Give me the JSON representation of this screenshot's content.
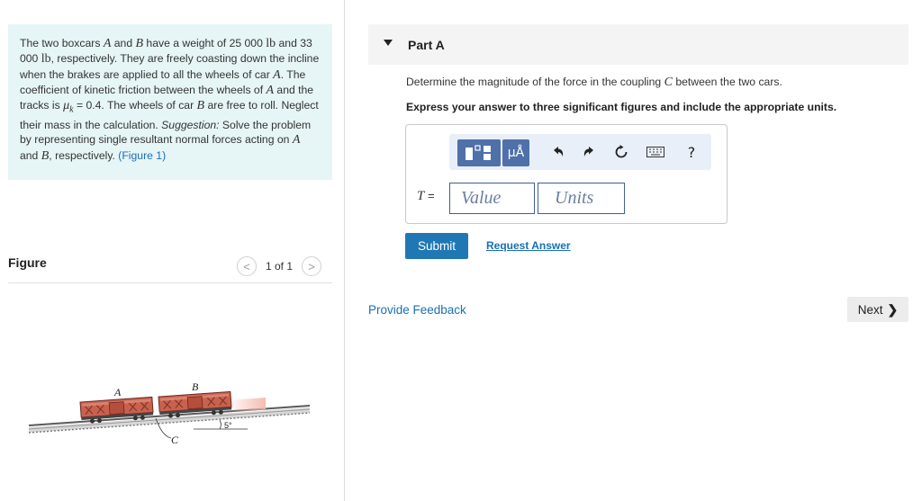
{
  "problem": {
    "text_1": "The two boxcars ",
    "var_a": "A",
    "text_2": " and ",
    "var_b": "B",
    "text_3": " have a weight of 25 000 ",
    "unit_lb_1": "lb",
    "text_4": " and 33 000 ",
    "unit_lb_2": "lb",
    "text_5": ", respectively. They are freely coasting down the incline when the brakes are applied to all the wheels of car ",
    "var_a2": "A",
    "text_6": ". The coefficient of kinetic friction between the wheels of ",
    "var_a3": "A",
    "text_7": " and the tracks is ",
    "mu_symbol": "μ",
    "mu_sub": "k",
    "text_8": " = 0.4. The wheels of car ",
    "var_b2": "B",
    "text_9": " are free to roll. Neglect their mass in the calculation. ",
    "suggestion_label": "Suggestion:",
    "text_10": " Solve the problem by representing single resultant normal forces acting on ",
    "var_a4": "A",
    "text_11": " and ",
    "var_b3": "B",
    "text_12": ", respectively. ",
    "figure_link": "(Figure 1)"
  },
  "figure": {
    "title": "Figure",
    "pager_text": "1 of 1",
    "prev_glyph": "<",
    "next_glyph": ">",
    "label_a": "A",
    "label_b": "B",
    "label_c": "C",
    "label_angle": "5°"
  },
  "part": {
    "title": "Part A",
    "question_1": "Determine the magnitude of the force in the coupling ",
    "question_var": "C",
    "question_2": " between the two cars.",
    "instruction": "Express your answer to three significant figures and include the appropriate units."
  },
  "answer": {
    "t_label": "T",
    "equals": " =",
    "value_placeholder": "Value",
    "units_placeholder": "Units",
    "unit_button_label": "μÅ",
    "help_label": "?"
  },
  "actions": {
    "submit": "Submit",
    "request_answer": "Request Answer",
    "provide_feedback": "Provide Feedback",
    "next": "Next",
    "next_chevron": "❯"
  },
  "colors": {
    "problem_bg": "#e6f5f6",
    "link": "#1a6fb5",
    "submit_bg": "#1f78b4",
    "toolbar_bg": "#e9eff8",
    "toolbar_button": "#4f70a8",
    "input_border": "#3e5f96",
    "boxcar_red": "#c9614f"
  }
}
